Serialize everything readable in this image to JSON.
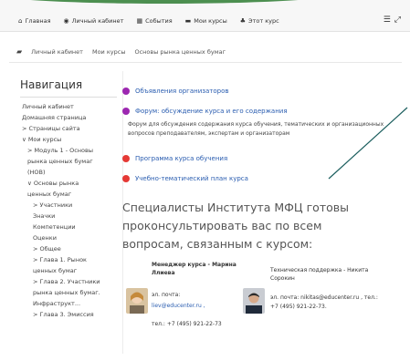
{
  "topnav": {
    "items": [
      {
        "icon": "home-icon",
        "label": "Главная"
      },
      {
        "icon": "dashboard-icon",
        "label": "Личный кабинет"
      },
      {
        "icon": "calendar-icon",
        "label": "События"
      },
      {
        "icon": "courses-icon",
        "label": "Мои курсы"
      },
      {
        "icon": "course-icon",
        "label": "Этот курс"
      }
    ],
    "right_icons": [
      "menu-icon",
      "expand-icon"
    ]
  },
  "breadcrumb": {
    "items": [
      "Личный кабинет",
      "Мои курсы",
      "Основы рынка ценных бумаг"
    ]
  },
  "navigation": {
    "title": "Навигация",
    "items": [
      {
        "level": 1,
        "text": "Личный кабинет"
      },
      {
        "level": 1,
        "text": "Домашняя страница"
      },
      {
        "level": 1,
        "text": "> Страницы сайта"
      },
      {
        "level": 1,
        "text": "∨ Мои курсы"
      },
      {
        "level": 2,
        "text": "> Модуль 1 - Основы"
      },
      {
        "level": 2,
        "text": "рынка ценных бумаг"
      },
      {
        "level": 2,
        "text": "(НОВ)"
      },
      {
        "level": 2,
        "text": "∨ Основы рынка"
      },
      {
        "level": 2,
        "text": "ценных бумаг"
      },
      {
        "level": 3,
        "text": "> Участники"
      },
      {
        "level": 3,
        "text": "Значки"
      },
      {
        "level": 3,
        "text": "Компетенции"
      },
      {
        "level": 3,
        "text": "Оценки"
      },
      {
        "level": 3,
        "text": "> Общее"
      },
      {
        "level": 3,
        "text": "> Глава 1. Рынок"
      },
      {
        "level": 3,
        "text": "ценных бумаг"
      },
      {
        "level": 3,
        "text": "> Глава 2. Участники"
      },
      {
        "level": 3,
        "text": "рынка ценных бумаг."
      },
      {
        "level": 3,
        "text": "Инфраструкт..."
      },
      {
        "level": 3,
        "text": "> Глава 3. Эмиссия"
      }
    ]
  },
  "activities": [
    {
      "label": "Объявления организаторов",
      "color": "#9c27b0"
    },
    {
      "label": "Форум: обсуждение курса и его содержания",
      "color": "#9c27b0"
    },
    {
      "label": "Программа курса обучения",
      "color": "#e53935"
    },
    {
      "label": "Учебно-тематический план курса",
      "color": "#e53935"
    }
  ],
  "forum_description": "Форум для обсуждения содержания курса обучения, тематических и организационных вопросов преподавателям, экспертам и организаторам",
  "specialists_heading": "Специалисты Института МФЦ готовы проконсультировать вас по всем вопросам, связанным с курсом:",
  "contacts": {
    "left": {
      "role": "Менеджер курса - Марина Ллиева",
      "email_label": "эл. почта:",
      "email": "liev@educenter.ru ,",
      "phone": "тел.: +7 (495) 921-22-73"
    },
    "right": {
      "role": "Техническая поддержка - Никита Сорокин",
      "line": "эл. почта: nikitas@educenter.ru , тел.: +7 (495) 921-22-73."
    }
  }
}
